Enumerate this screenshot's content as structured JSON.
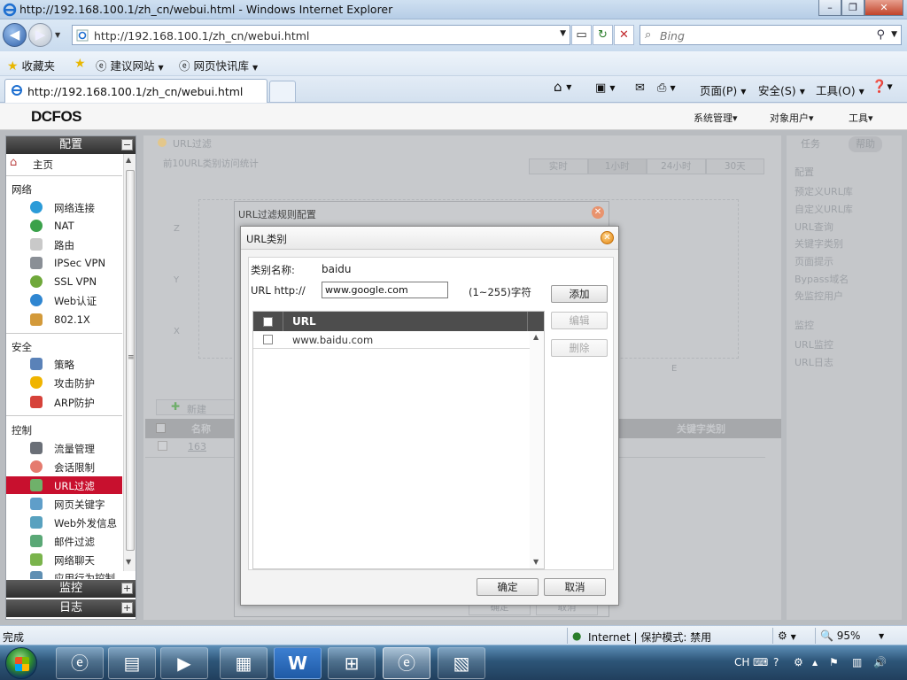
{
  "window": {
    "title": "http://192.168.100.1/zh_cn/webui.html - Windows Internet Explorer",
    "min": "–",
    "max": "❐",
    "close": "✕"
  },
  "address": {
    "url": "http://192.168.100.1/zh_cn/webui.html",
    "search_placeholder": "Bing"
  },
  "favorites": {
    "favorites_label": "收藏夹",
    "suggested_sites": "建议网站",
    "web_slice_gallery": "网页快讯库"
  },
  "tab": {
    "title": "http://192.168.100.1/zh_cn/webui.html"
  },
  "commands": {
    "page": "页面(P)",
    "safety": "安全(S)",
    "tools": "工具(O)"
  },
  "app": {
    "logo": "DCFOS",
    "top_menu": {
      "system": "系统管理",
      "objects": "对象用户",
      "tools": "工具"
    }
  },
  "sidebar": {
    "config_header": "配置",
    "home": "主页",
    "network_section": "网络",
    "network_items": [
      "网络连接",
      "NAT",
      "路由",
      "IPSec VPN",
      "SSL VPN",
      "Web认证",
      "802.1X"
    ],
    "security_section": "安全",
    "security_items": [
      "策略",
      "攻击防护",
      "ARP防护"
    ],
    "control_section": "控制",
    "control_items": [
      "流量管理",
      "会话限制",
      "URL过滤",
      "网页关键字",
      "Web外发信息",
      "邮件过滤",
      "网络聊天",
      "应用行为控制"
    ],
    "selected": "URL过滤",
    "monitor_header": "监控",
    "log_header": "日志"
  },
  "background_content": {
    "page_title": "URL过滤",
    "stats_title": "前10URL类别访问统计",
    "time_buttons": [
      "实时",
      "1小时",
      "24小时",
      "30天"
    ],
    "axis_labels": [
      "Z",
      "Y",
      "X",
      "E"
    ],
    "new_button": "新建",
    "table_headers": [
      "名称",
      "关键字类别"
    ],
    "table_row": "163",
    "ok": "确定",
    "cancel": "取消"
  },
  "right_panel": {
    "tab_tasks": "任务",
    "tab_help": "帮助",
    "config_section": "配置",
    "config_links": [
      "预定义URL库",
      "自定义URL库",
      "URL查询",
      "关键字类别",
      "页面提示",
      "Bypass域名",
      "免监控用户"
    ],
    "monitor_section": "监控",
    "monitor_links": [
      "URL监控",
      "URL日志"
    ]
  },
  "dialog_outer": {
    "title": "URL过滤规则配置"
  },
  "dialog": {
    "title": "URL类别",
    "category_name_label": "类别名称:",
    "category_name_value": "baidu",
    "url_label": "URL http://",
    "url_value": "www.google.com",
    "url_hint": "(1~255)字符",
    "add_button": "添加",
    "edit_button": "编辑",
    "delete_button": "删除",
    "grid_header": "URL",
    "grid_rows": [
      "www.baidu.com"
    ],
    "ok_button": "确定",
    "cancel_button": "取消"
  },
  "status": {
    "done": "完成",
    "zone": "Internet | 保护模式: 禁用",
    "zoom": "95%"
  },
  "tray": {
    "ime": "CH"
  }
}
